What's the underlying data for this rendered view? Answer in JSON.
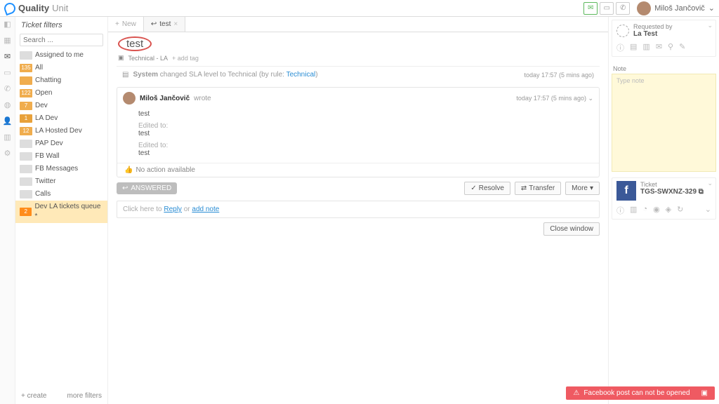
{
  "brand": {
    "name": "Quality",
    "suffix": "Unit"
  },
  "topbar": {
    "user_name": "Miloš Jančovič"
  },
  "sidebar": {
    "title": "Ticket filters",
    "search_placeholder": "Search ...",
    "items": [
      {
        "label": "Assigned to me",
        "badge": "",
        "cls": ""
      },
      {
        "label": "All",
        "badge": "135",
        "cls": "orange"
      },
      {
        "label": "Chatting",
        "badge": "",
        "cls": "orange"
      },
      {
        "label": "Open",
        "badge": "122",
        "cls": "orange"
      },
      {
        "label": "Dev",
        "badge": "7",
        "cls": "orange"
      },
      {
        "label": "LA Dev",
        "badge": "1",
        "cls": "amber"
      },
      {
        "label": "LA Hosted Dev",
        "badge": "12",
        "cls": "orange"
      },
      {
        "label": "PAP Dev",
        "badge": "",
        "cls": ""
      },
      {
        "label": "FB Wall",
        "badge": "",
        "cls": ""
      },
      {
        "label": "FB Messages",
        "badge": "",
        "cls": ""
      },
      {
        "label": "Twitter",
        "badge": "",
        "cls": ""
      },
      {
        "label": "Calls",
        "badge": "",
        "cls": ""
      },
      {
        "label": "Dev LA tickets queue *",
        "badge": "2",
        "cls": "orange",
        "sel": true
      }
    ],
    "create": "create",
    "more": "more filters"
  },
  "tabs": {
    "new": "New",
    "active": "test"
  },
  "ticket": {
    "title": "test",
    "dept": "Technical - LA",
    "addtag": "+  add tag",
    "system_prefix": "System",
    "system_text": " changed SLA level to Technical (by rule: ",
    "system_link": "Technical",
    "system_suffix": ")",
    "time": "today 17:57 (5 mins ago)"
  },
  "message": {
    "author": "Miloš Jančovič",
    "wrote": "wrote",
    "body": "test",
    "edited": "Edited to:",
    "body2": "test",
    "body3": "test",
    "time": "today 17:57 (5 mins ago)",
    "noaction": "No action available"
  },
  "actions": {
    "status": "ANSWERED",
    "resolve": "Resolve",
    "transfer": "Transfer",
    "more": "More"
  },
  "reply": {
    "prefix": "Click here to ",
    "reply": "Reply",
    "or": " or ",
    "note": "add note"
  },
  "close_window": "Close window",
  "rsb": {
    "req_label": "Requested by",
    "req_name": "La Test",
    "note_label": "Note",
    "note_placeholder": "Type note",
    "ticket_label": "Ticket",
    "ticket_id": "TGS-SWXNZ-329"
  },
  "toast": "Facebook post can not be opened"
}
